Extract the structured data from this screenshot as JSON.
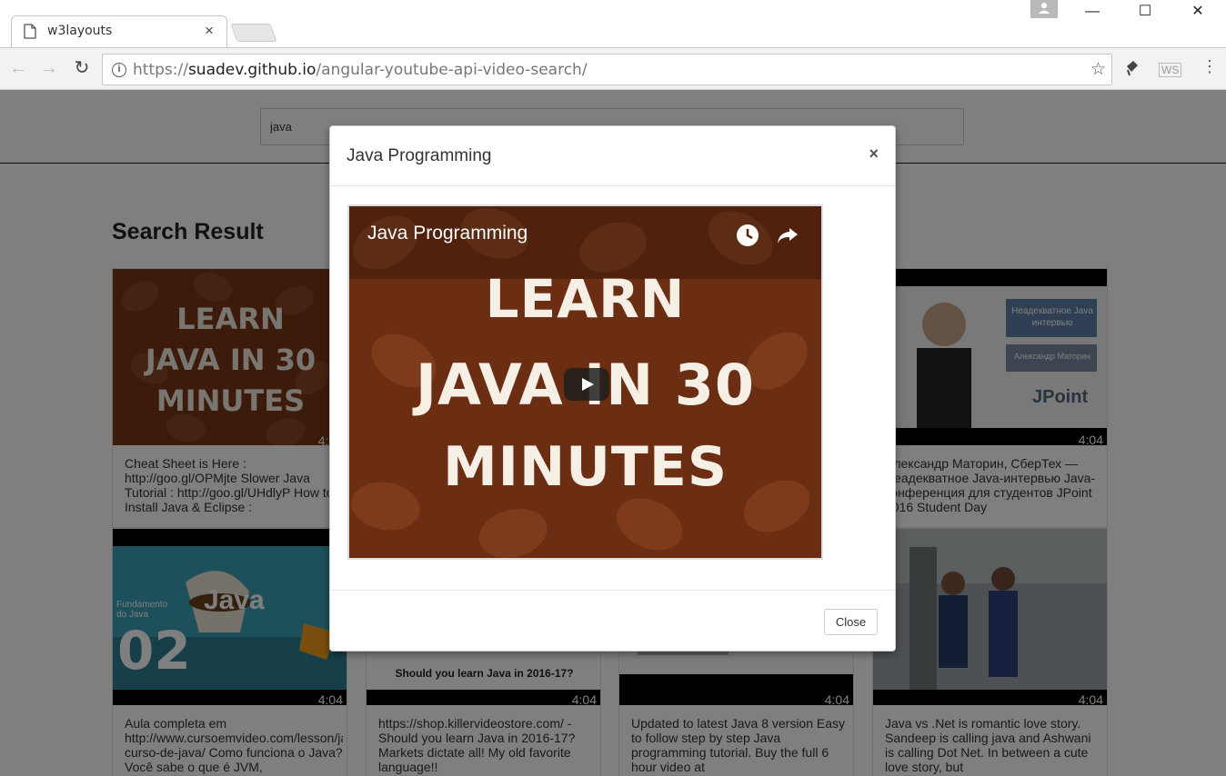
{
  "browser": {
    "tab_title": "w3layouts",
    "tab_close": "×",
    "url_scheme": "https://",
    "url_host": "suadev.github.io",
    "url_path": "/angular-youtube-api-video-search/",
    "window_controls": [
      "—",
      "☐",
      "✕"
    ],
    "ext_label": "WS"
  },
  "page": {
    "search_value": "java",
    "result_heading": "Search Result",
    "cards": [
      {
        "duration": "4:04",
        "description": "Cheat Sheet is Here : http://goo.gl/OPMjte Slower Java Tutorial : http://goo.gl/UHdlyP How to Install Java & Eclipse : http://goo.gl/nEEdJF"
      },
      {
        "duration": "4:04",
        "description": "Александр Маторин, СберТех — Неадекватное Java-интервью Java-конференция для студентов JPoint 2016 Student Day"
      },
      {
        "duration": "4:04",
        "description": "Aula completa em http://www.cursoemvideo.com/lesson/java-curso-de-java/ Como funciona o Java? Você sabe o que é JVM,"
      },
      {
        "duration": "4:04",
        "description": "https://shop.killervideostore.com/ - Should you learn Java in 2016-17? Markets dictate all! My old favorite language!!"
      },
      {
        "duration": "4:04",
        "description": "Updated to latest Java 8 version Easy to follow step by step Java programming tutorial. Buy the full 6 hour video at"
      },
      {
        "duration": "4:04",
        "description": "Java vs .Net is romantic love story. Sandeep is calling java and Ashwani is calling Dot Net. In between a cute love story, but"
      }
    ],
    "thumb_texts": {
      "learn": [
        "LEARN",
        "JAVA IN 30",
        "MINUTES"
      ],
      "jpoint_box1": "Неадекватное Java интервью",
      "jpoint_box2": "Александр Маторин",
      "jpoint_logo": "JPoint",
      "cursoemvideo_left": "Fundamento do Java",
      "cursoemvideo_num": "02",
      "cursoemvideo_java": "Java",
      "killer_caption": "Should you learn Java in 2016-17?"
    }
  },
  "modal": {
    "title": "Java Programming",
    "close_x": "×",
    "video_title": "Java Programming",
    "video_lines": [
      "LEARN",
      "JAVA IN 30",
      "MINUTES"
    ],
    "close_button": "Close"
  },
  "colors": {
    "overlay": "rgba(0,0,0,0.5)",
    "coffee_brown": "#7a3717",
    "video_bg": "#6b2e12"
  }
}
